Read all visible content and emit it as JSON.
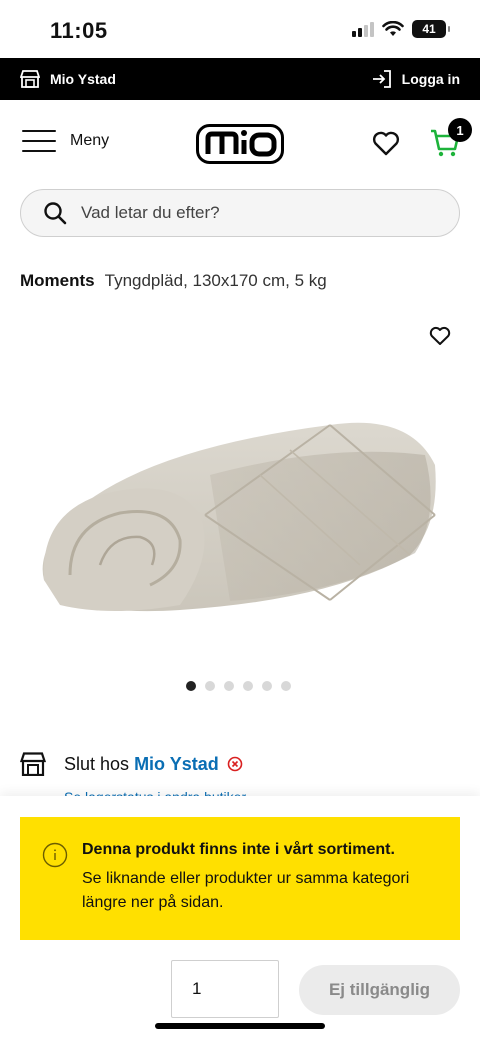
{
  "status_bar": {
    "time": "11:05",
    "battery": "41",
    "icons": [
      "signal-icon",
      "wifi-icon",
      "battery-icon"
    ]
  },
  "store_bar": {
    "store_name": "Mio Ystad",
    "login_label": "Logga in",
    "icons": [
      "store-icon",
      "login-icon"
    ]
  },
  "header": {
    "menu_label": "Meny",
    "logo_text": "mio",
    "cart_count": "1",
    "colors": {
      "cart": "#1db33a",
      "logo": "#000000"
    },
    "icons": [
      "hamburger-icon",
      "heart-icon",
      "cart-icon"
    ]
  },
  "search": {
    "placeholder": "Vad letar du efter?",
    "icon": "search-icon"
  },
  "product": {
    "brand": "Moments",
    "name": "Tyngdpläd, 130x170 cm, 5 kg",
    "image_count": 6,
    "active_image": 1
  },
  "stock": {
    "prefix": "Slut hos",
    "store": "Mio Ystad",
    "link_text": "Se lagerstatus i andra butiker",
    "icons": [
      "store-icon",
      "out-of-stock-icon"
    ],
    "status_color": "#d92020"
  },
  "notice": {
    "title": "Denna produkt finns inte i vårt sortiment.",
    "text": "Se liknande eller produkter ur samma kategori längre ner på sidan.",
    "background": "#ffe000",
    "icon": "info-icon"
  },
  "purchase": {
    "quantity": "1",
    "button_label": "Ej tillgänglig"
  }
}
